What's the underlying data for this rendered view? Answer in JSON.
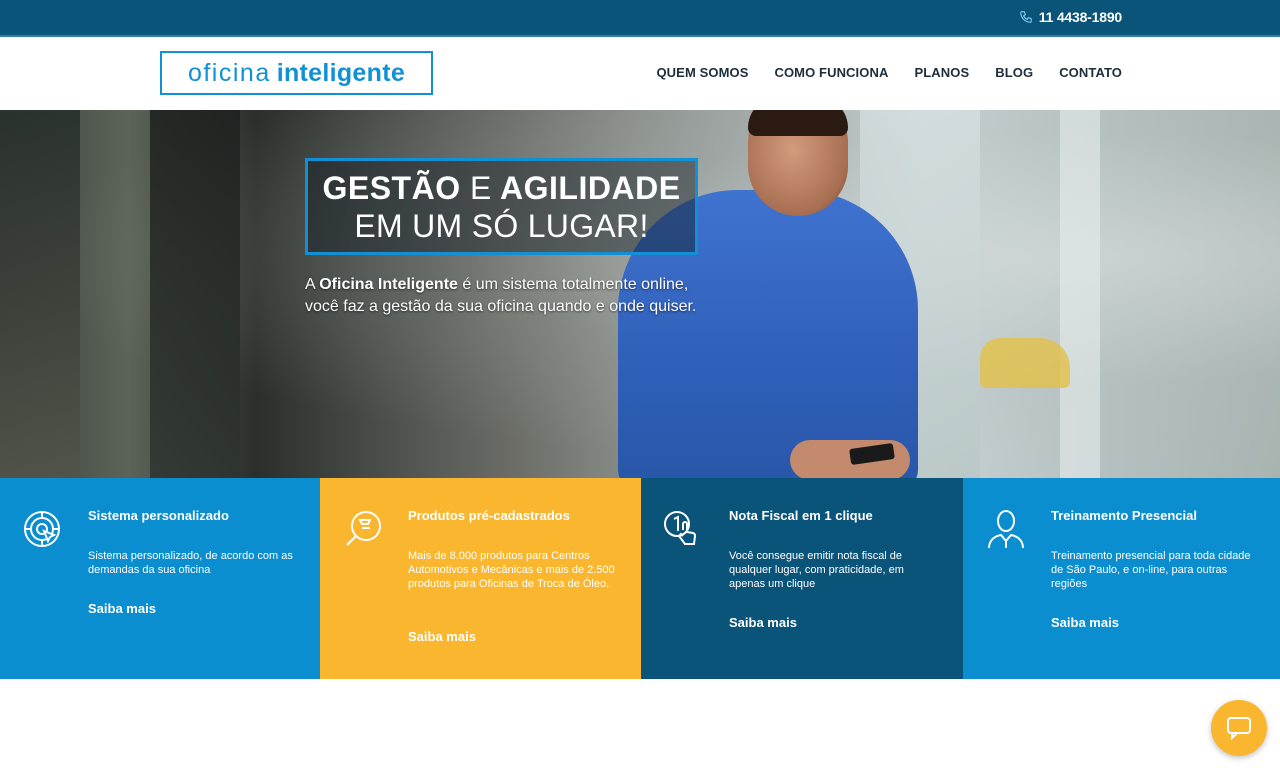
{
  "topbar": {
    "phone": "11 4438-1890",
    "phone_icon": "phone-icon"
  },
  "header": {
    "logo_part1": "oficina",
    "logo_part2": "inteligente",
    "nav": [
      "QUEM SOMOS",
      "COMO FUNCIONA",
      "PLANOS",
      "BLOG",
      "CONTATO"
    ]
  },
  "hero": {
    "headline_bold1": "GESTÃO",
    "headline_connector": "E",
    "headline_bold2": "AGILIDADE",
    "headline_line2": "EM UM SÓ LUGAR!",
    "sub_prefix": "A ",
    "sub_brand": "Oficina Inteligente",
    "sub_rest1": " é um sistema totalmente online,",
    "sub_line2": "você faz a gestão da sua oficina quando e onde quiser."
  },
  "features": [
    {
      "icon": "target-cursor-icon",
      "title": "Sistema personalizado",
      "desc": "Sistema personalizado, de acordo com as demandas da sua oficina",
      "link": "Saiba mais",
      "color": "#0a8ed0"
    },
    {
      "icon": "wrench-search-icon",
      "title": "Produtos pré-cadastrados",
      "desc": "Mais de 8.000 produtos para Centros Automotivos e Mecânicas e mais de 2.500 produtos para Oficinas de Troca de Óleo.",
      "link": "Saiba mais",
      "color": "#fbb630"
    },
    {
      "icon": "one-click-hand-icon",
      "title": "Nota Fiscal em 1 clique",
      "desc": "Você consegue emitir nota fiscal de qualquer lugar, com praticidade, em apenas um clique",
      "link": "Saiba mais",
      "color": "#0b5479"
    },
    {
      "icon": "person-trainer-icon",
      "title": "Treinamento Presencial",
      "desc": "Treinamento presencial para toda cidade de São Paulo, e on-line, para outras regiões",
      "link": "Saiba mais",
      "color": "#0a8ed0"
    }
  ],
  "chat": {
    "icon": "chat-bubble-icon"
  }
}
